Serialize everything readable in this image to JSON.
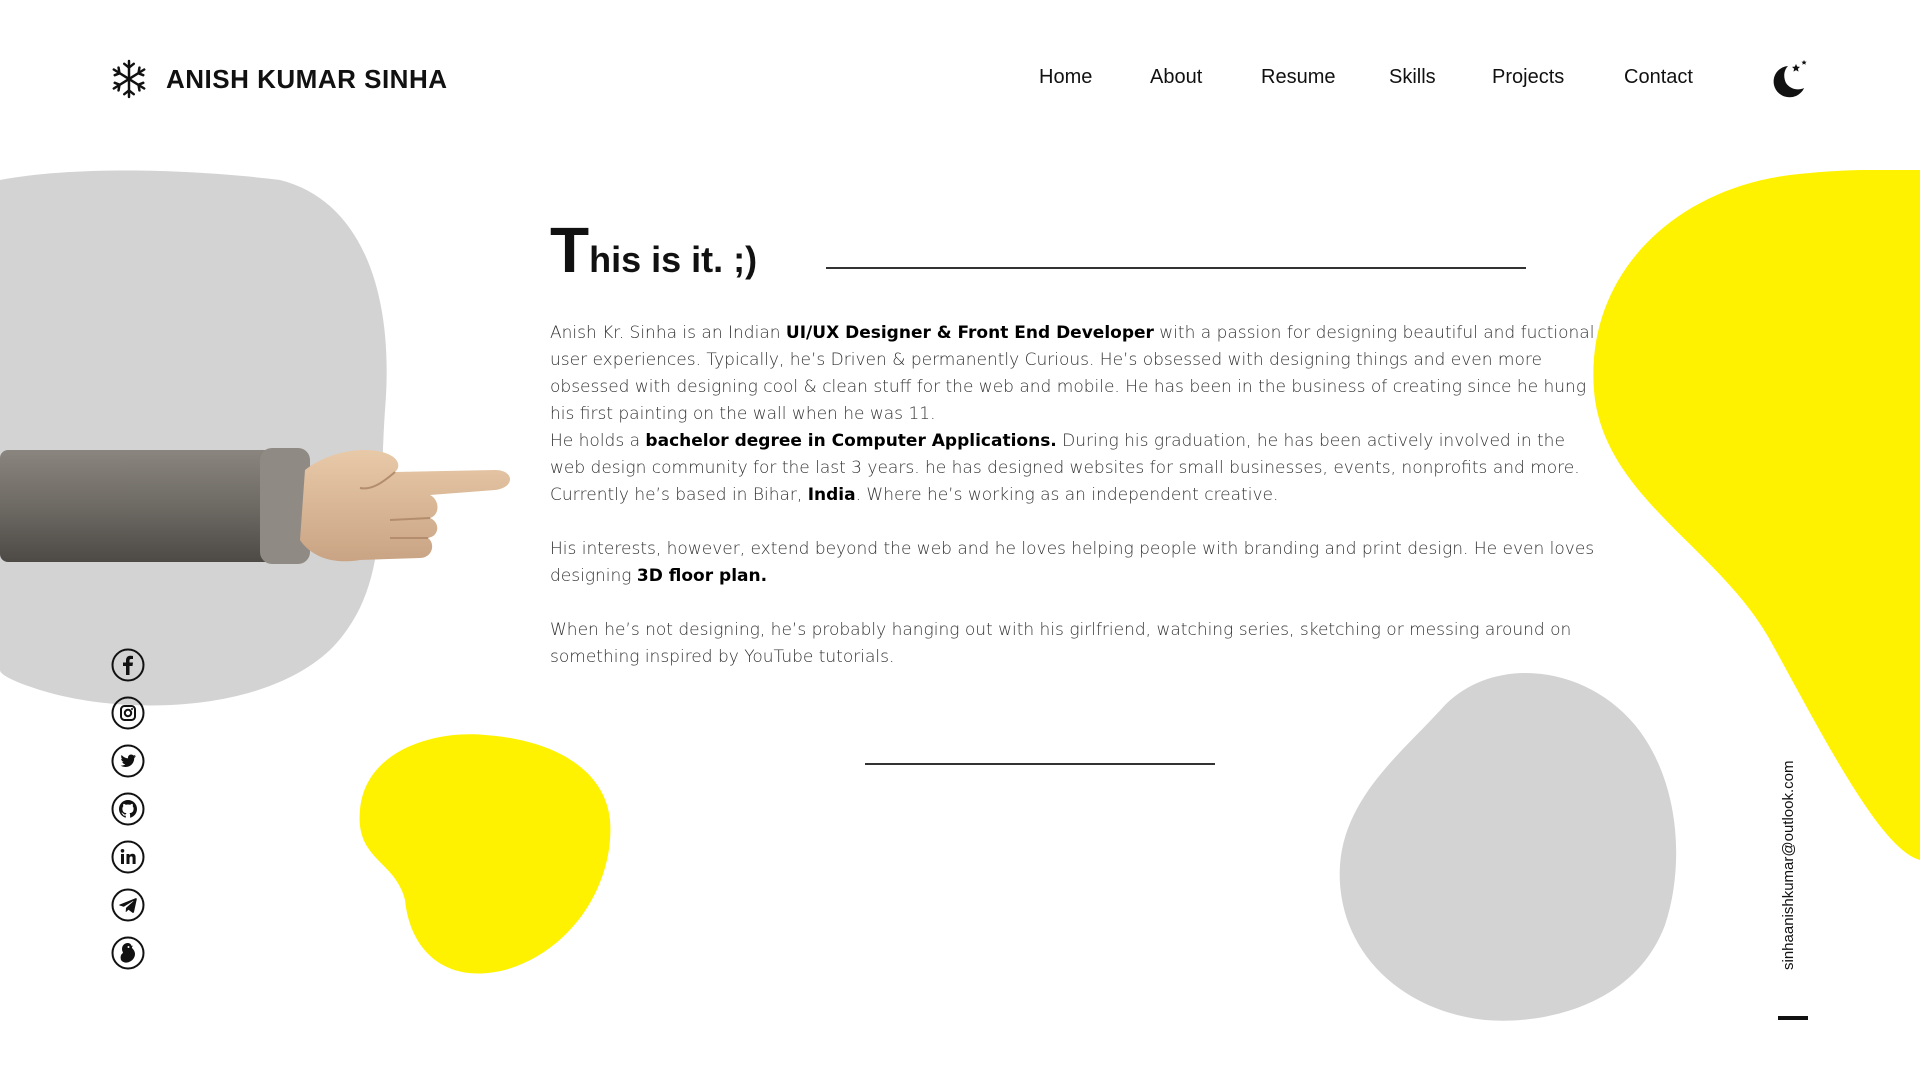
{
  "brand": {
    "name": "ANISH KUMAR SINHA"
  },
  "nav": [
    {
      "label": "Home"
    },
    {
      "label": "About"
    },
    {
      "label": "Resume"
    },
    {
      "label": "Skills"
    },
    {
      "label": "Projects"
    },
    {
      "label": "Contact"
    }
  ],
  "theme_toggle": {
    "icon": "moon-stars-icon"
  },
  "section": {
    "title_first": "T",
    "title_rest": "his is it. ;)"
  },
  "bio": {
    "p1_a": "Anish Kr. Sinha is an Indian ",
    "p1_hl": "UI/UX Designer & Front End Developer",
    "p1_b": " with a passion for designing beautiful and fuctional user experiences. Typically, he’s Driven & permanently Curious. He’s obsessed with designing things and even more obsessed with designing cool & clean stuff for the web and mobile. He has been in the business of creating since he hung his first painting on the wall when he was 11.",
    "p2_a": "He holds a ",
    "p2_hl": "bachelor degree in Computer Applications.",
    "p2_b": " During his graduation, he has been actively involved in the web design community for the last 3 years. he has designed websites for small businesses, events, nonprofits and more. Currently he’s based in Bihar, ",
    "p2_hl2": "India",
    "p2_c": ". Where he’s working as an independent creative.",
    "p3_a": "His interests, however, extend beyond the web and he loves helping people with branding and print design. He even loves designing ",
    "p3_hl": "3D floor plan.",
    "p4": "When he’s not designing, he’s probably hanging out with his girlfriend, watching series, sketching or messing around on something inspired by YouTube tutorials."
  },
  "socials": [
    {
      "icon": "facebook-icon"
    },
    {
      "icon": "instagram-icon"
    },
    {
      "icon": "twitter-icon"
    },
    {
      "icon": "github-icon"
    },
    {
      "icon": "linkedin-icon"
    },
    {
      "icon": "telegram-icon"
    },
    {
      "icon": "bird-icon"
    }
  ],
  "contact": {
    "email": "sinhaanishkumar@outlook.com"
  },
  "colors": {
    "accent_yellow": "#FFF200",
    "blob_gray": "#D3D3D3",
    "text": "#111111"
  }
}
